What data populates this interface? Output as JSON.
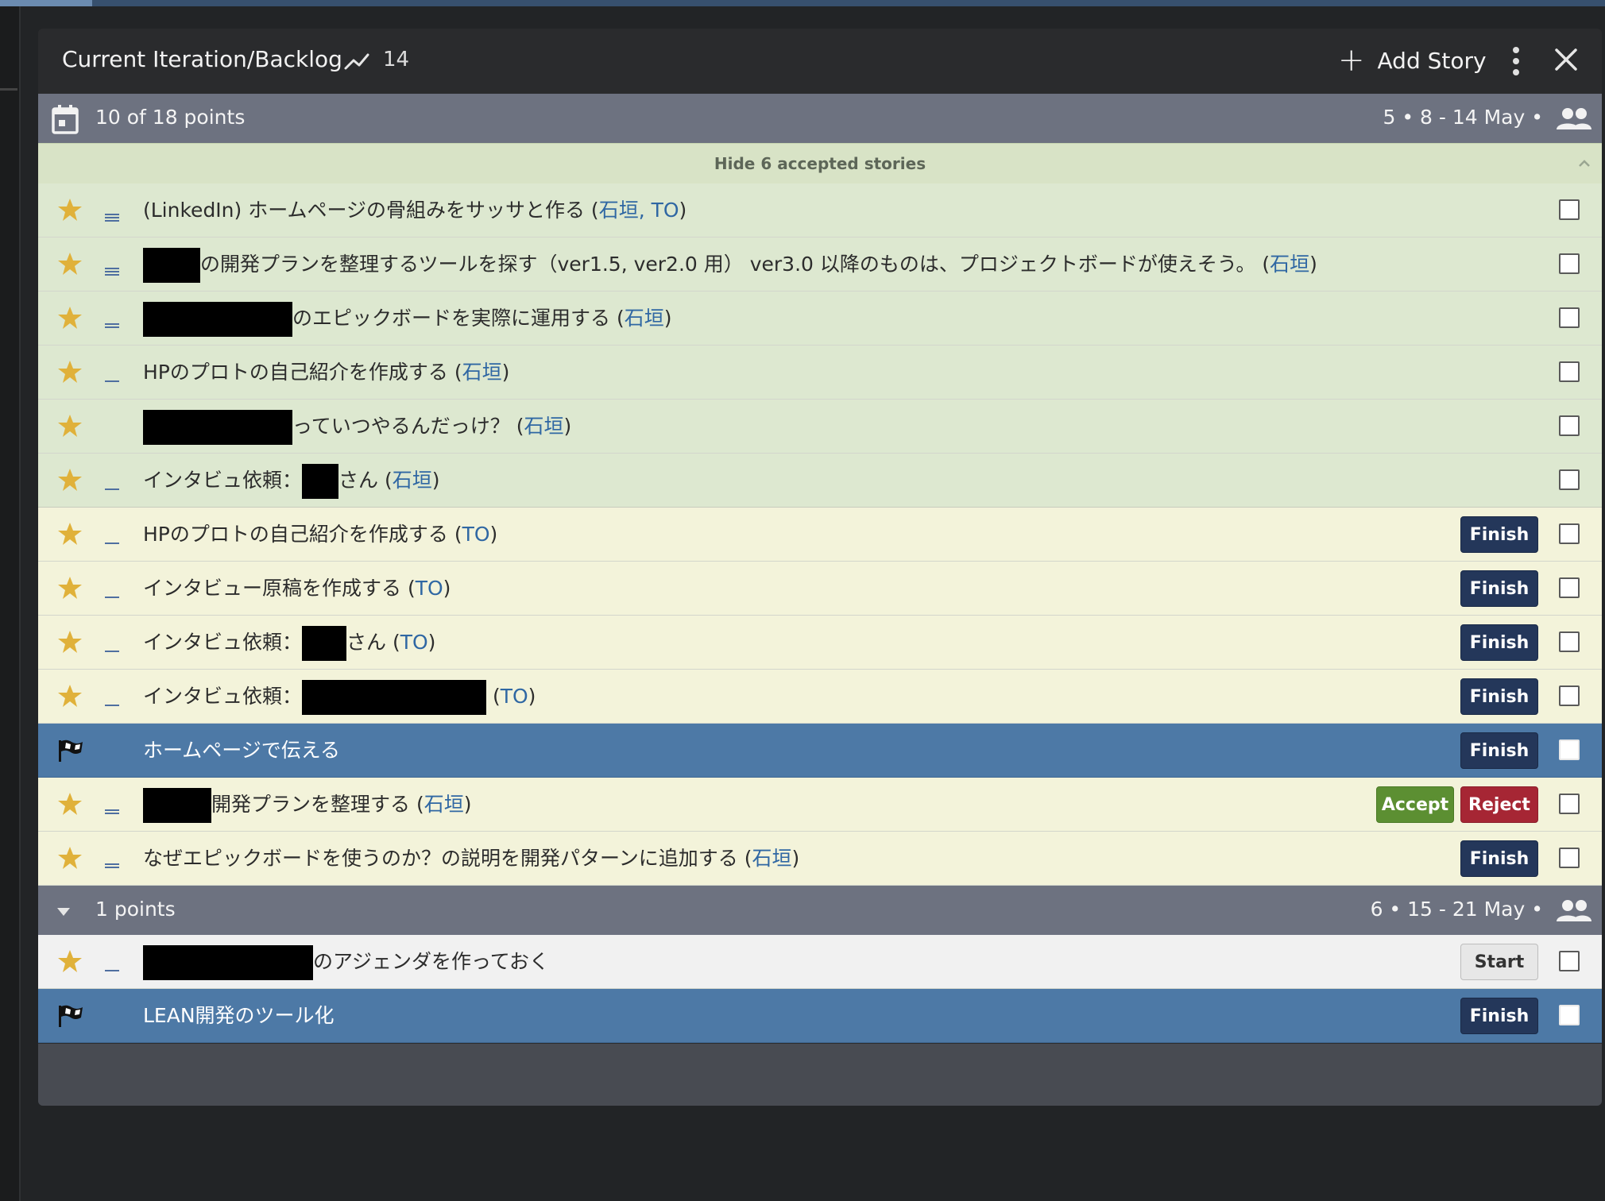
{
  "panel": {
    "title": "Current Iteration/Backlog",
    "velocity": "14",
    "add_story_label": "Add Story"
  },
  "iterations": [
    {
      "points": "10 of 18 points",
      "dates": "5 • 8 - 14 May •"
    },
    {
      "points": "1 points",
      "dates": "6 • 15 - 21 May •"
    }
  ],
  "accepted_toggle_label": "Hide 6 accepted stories",
  "stories": [
    {
      "state": "accepted",
      "before": "(LinkedIn) ホームページの骨組みをサッサと作る (",
      "owner": "石垣, TO",
      "after": ")"
    },
    {
      "state": "accepted",
      "before": "の開発プランを整理するツールを探す（ver1.5, ver2.0 用） ver3.0 以降のものは、プロジェクトボードが使えそう。 (",
      "owner": "石垣",
      "after": ")"
    },
    {
      "state": "accepted",
      "before": "のエピックボードを実際に運用する (",
      "owner": "石垣",
      "after": ")"
    },
    {
      "state": "accepted",
      "before": "HPのプロトの自己紹介を作成する (",
      "owner": "石垣",
      "after": ")"
    },
    {
      "state": "accepted",
      "before": "っていつやるんだっけ？ (",
      "owner": "石垣",
      "after": ")"
    },
    {
      "state": "accepted",
      "before": "インタビュ依頼：",
      "middle": "さん (",
      "owner": "石垣",
      "after": ")"
    },
    {
      "state": "started",
      "before": "HPのプロトの自己紹介を作成する (",
      "owner": "TO",
      "after": ")",
      "button": "Finish"
    },
    {
      "state": "started",
      "before": "インタビュー原稿を作成する (",
      "owner": "TO",
      "after": ")",
      "button": "Finish"
    },
    {
      "state": "started",
      "before": "インタビュ依頼：",
      "middle": "さん (",
      "owner": "TO",
      "after": ")",
      "button": "Finish"
    },
    {
      "state": "started",
      "before": "インタビュ依頼：",
      "middle": " (",
      "owner": "TO",
      "after": ")",
      "button": "Finish"
    },
    {
      "state": "release",
      "before": "ホームページで伝える",
      "button": "Finish"
    },
    {
      "state": "delivered",
      "before": "開発プランを整理する (",
      "owner": "石垣",
      "after": ")",
      "button_accept": "Accept",
      "button_reject": "Reject"
    },
    {
      "state": "started",
      "before": "なぜエピックボードを使うのか？の説明を開発パターンに追加する (",
      "owner": "石垣",
      "after": ")",
      "button": "Finish"
    },
    {
      "state": "unstarted",
      "before": "のアジェンダを作っておく",
      "button": "Start"
    },
    {
      "state": "release",
      "before": "LEAN開発のツール化",
      "button": "Finish"
    }
  ],
  "colors": {
    "accepted_row": "#dde8d0",
    "active_row": "#f3f3da",
    "release_row": "#4d79a6",
    "finish_button": "#24375a",
    "accept_button": "#5c8f32",
    "reject_button": "#a62634",
    "owner_link": "#2f67a3",
    "star": "#e0b13a"
  }
}
